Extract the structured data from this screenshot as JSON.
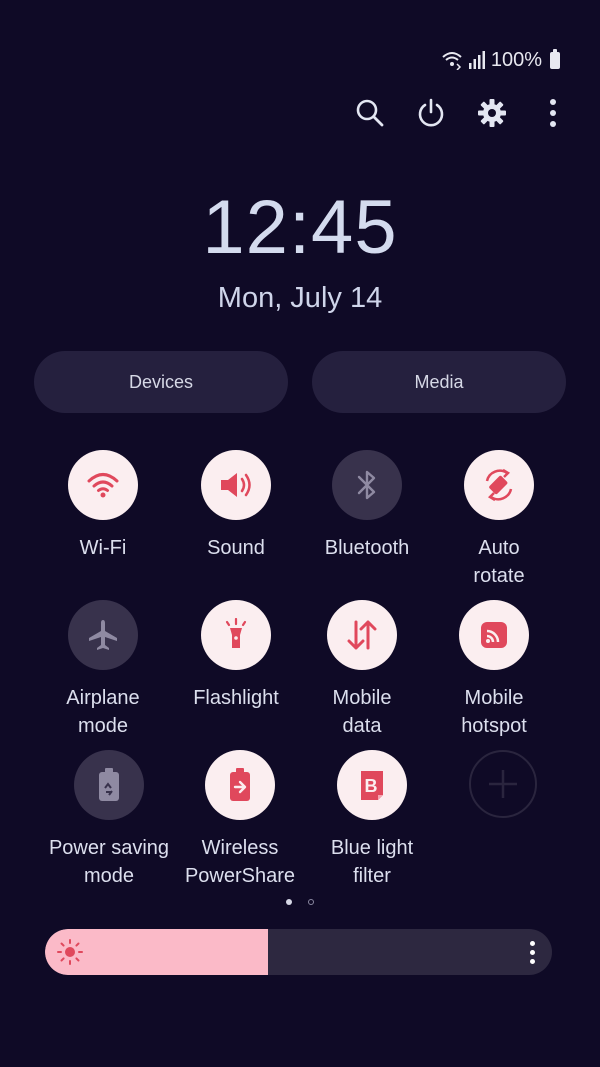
{
  "status_bar": {
    "battery_percent": "100%",
    "icons": [
      "wifi-calling-icon",
      "signal-icon",
      "battery-icon"
    ]
  },
  "toolbar": {
    "icons": [
      "search-icon",
      "power-icon",
      "settings-gear-icon",
      "more-vert-icon"
    ]
  },
  "clock": {
    "time": "12:45",
    "date": "Mon, July 14"
  },
  "panels": {
    "devices_label": "Devices",
    "media_label": "Media"
  },
  "tiles": [
    {
      "label": "Wi-Fi",
      "state": "on",
      "icon": "wifi-icon"
    },
    {
      "label": "Sound",
      "state": "on",
      "icon": "volume-icon"
    },
    {
      "label": "Bluetooth",
      "state": "off",
      "icon": "bluetooth-icon"
    },
    {
      "label": "Auto\nrotate",
      "state": "on",
      "icon": "auto-rotate-icon"
    },
    {
      "label": "Airplane\nmode",
      "state": "off",
      "icon": "airplane-icon"
    },
    {
      "label": "Flashlight",
      "state": "on",
      "icon": "flashlight-icon"
    },
    {
      "label": "Mobile\ndata",
      "state": "on",
      "icon": "mobile-data-icon"
    },
    {
      "label": "Mobile\nhotspot",
      "state": "on",
      "icon": "hotspot-icon"
    },
    {
      "label": "Power saving\nmode",
      "state": "off",
      "icon": "power-saving-icon"
    },
    {
      "label": "Wireless\nPowerShare",
      "state": "on",
      "icon": "wireless-powershare-icon"
    },
    {
      "label": "Blue light\nfilter",
      "state": "on",
      "icon": "blue-light-filter-icon"
    },
    {
      "label": "",
      "state": "add",
      "icon": "add-icon"
    }
  ],
  "pager": {
    "current_page": 1,
    "total_pages": 2
  },
  "brightness": {
    "level": 0.44
  },
  "colors": {
    "background": "#0f0a26",
    "tile_on": "#fbeef0",
    "tile_off": "#38324c",
    "accent_icon": "#e0485c",
    "brightness_fill": "#fbbac8"
  }
}
